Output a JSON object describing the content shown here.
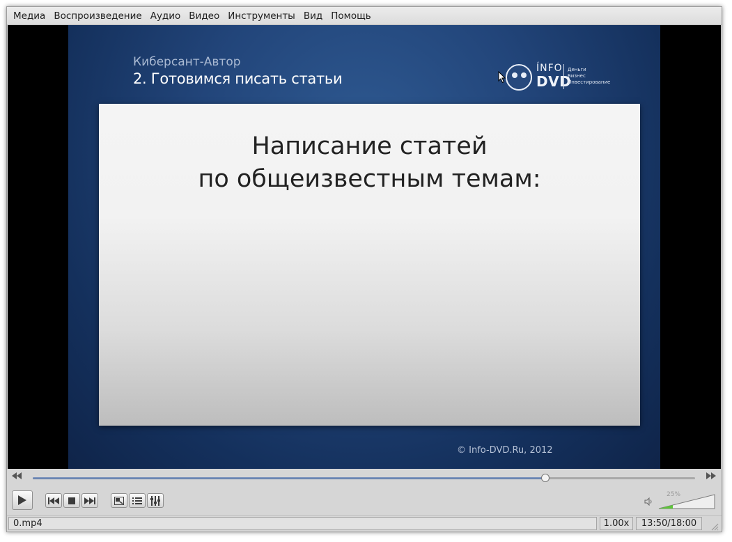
{
  "menubar": {
    "items": [
      "Медиа",
      "Воспроизведение",
      "Аудио",
      "Видео",
      "Инструменты",
      "Вид",
      "Помощь"
    ]
  },
  "video": {
    "course_name": "Киберсант-Автор",
    "lesson_title": "2. Готовимся писать статьи",
    "logo": {
      "line1": "ÍNFO",
      "line2": "DVD",
      "tagline": [
        "Деньги",
        "Бизнес",
        "Инвестирование"
      ]
    },
    "board_heading_line1": "Написание статей",
    "board_heading_line2": "по общеизвестным темам:",
    "copyright": "© Info-DVD.Ru, 2012"
  },
  "seek": {
    "position_fraction": 0.774
  },
  "volume": {
    "label": "25%",
    "level_fraction": 0.25
  },
  "status": {
    "filename": "0.mp4",
    "speed": "1.00x",
    "time": "13:50/18:00"
  },
  "icons": {
    "play": "play-icon",
    "previous": "previous-icon",
    "stop": "stop-icon",
    "next": "next-icon",
    "fullscreen": "fullscreen-icon",
    "playlist": "playlist-icon",
    "extended_settings": "equalizer-icon",
    "speaker": "speaker-icon"
  },
  "colors": {
    "slide_bg": "#22457a",
    "seek_fill": "#5d79a8",
    "volume_fill": "#5ec53a"
  }
}
